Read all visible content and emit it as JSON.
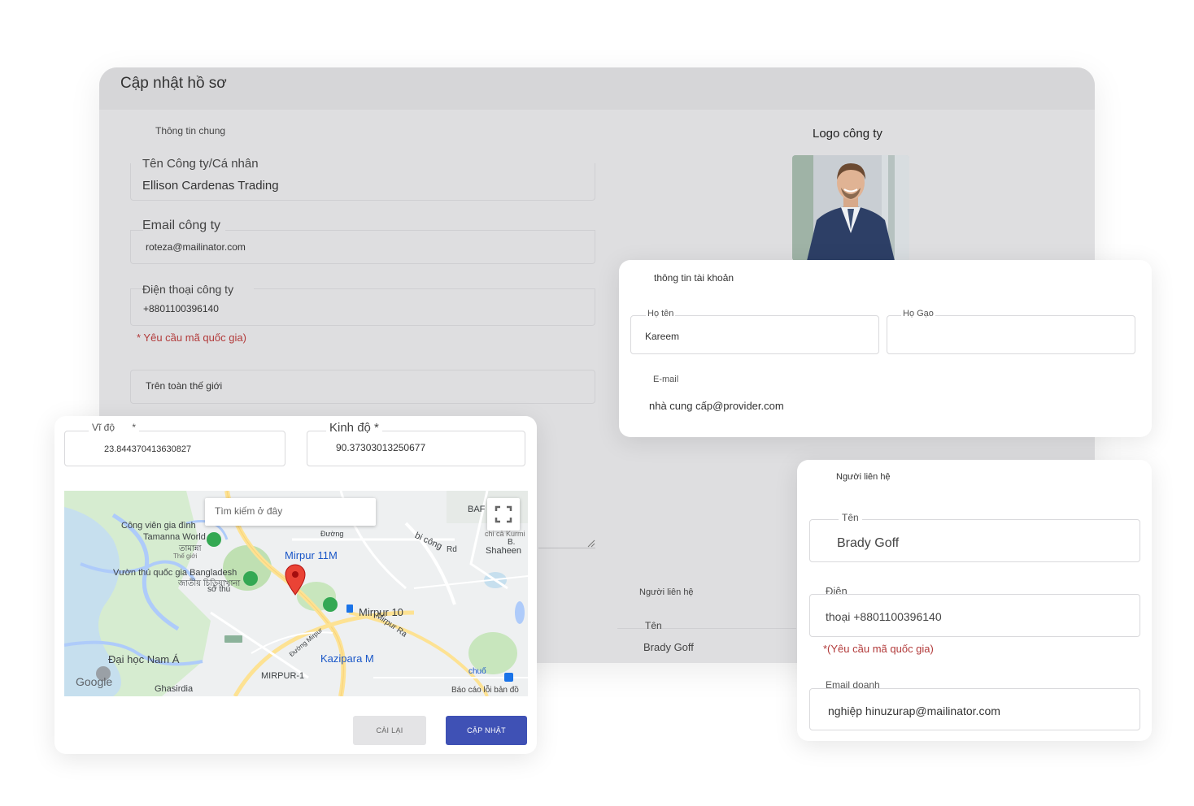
{
  "profile": {
    "title": "Cập nhật hồ sơ",
    "general_legend": "Thông tin chung",
    "company_label": "Tên Công ty/Cá nhân",
    "company_value": "Ellison Cardenas Trading",
    "email_label": "Email công ty",
    "email_value": "roteza@mailinator.com",
    "phone_label": "Điện thoại công ty",
    "phone_value": "+8801100396140",
    "phone_hint": "* Yêu cầu mã quốc gia)",
    "region_value": "Trên toàn thế giới",
    "logo_label": "Logo công ty",
    "contact_legend": "Người liên hệ",
    "contact_name_label": "Tên",
    "contact_name_value": "Brady Goff"
  },
  "account": {
    "legend": "thông tin tài khoản",
    "fullname_label": "Họ tên",
    "fullname_value": "Kareem",
    "lastname_label": "Họ Gạo",
    "email_label": "E-mail",
    "email_value": "nhà cung cấp@provider.com"
  },
  "location": {
    "lat_label": "Vĩ độ",
    "lat_req": "*",
    "lat_value": "23.844370413630827",
    "lng_label": "Kinh độ *",
    "lng_value": "90.37303013250677",
    "map": {
      "search_placeholder": "Tìm kiếm ở đây",
      "labels": {
        "park": "Công viên gia đình",
        "park2": "Tamanna World",
        "park3": "তামান্না",
        "park4": "Thế giới",
        "zoo": "Vườn thú quốc gia Bangladesh",
        "zoo2": "জাতীয় চিড়িয়াখানা",
        "zoo3": "sở thú",
        "mirpur11": "Mirpur 11M",
        "mirpur10": "Mirpur 10",
        "mirpur_rd": "Mirpur Ra",
        "kazipara": "Kazipara M",
        "univ": "Đại học Nam Á",
        "ghasirdia": "Ghasirdia",
        "mirpur1": "MIRPUR-1",
        "duong": "Đường",
        "duong_mirpur": "Đường Mirpur",
        "bicong": "bi công",
        "rd": "Rd",
        "shaheen": "Shaheen",
        "baf": "BAF",
        "chicakurmi": "chi cả Kurmi",
        "b": "B.",
        "chusaa": "chuố",
        "google": "Google",
        "report": "Báo cáo lỗi bản đồ"
      }
    },
    "reset_label": "CÀI LẠI",
    "update_label": "CẬP NHẬT"
  },
  "contact": {
    "legend": "Người liên hệ",
    "name_label": "Tên",
    "name_value": "Brady Goff",
    "phone_label": "Điện",
    "phone_value": "thoại +8801100396140",
    "phone_hint": "*(Yêu cầu mã quốc gia)",
    "email_label": "Email doanh",
    "email_value": "nghiệp hinuzurap@mailinator.com"
  },
  "colors": {
    "primary": "#3f51b5",
    "hint_red": "#b23a3a",
    "map_marker": "#ea4335",
    "map_water": "#aecbfa",
    "map_green": "#cde8c6"
  }
}
